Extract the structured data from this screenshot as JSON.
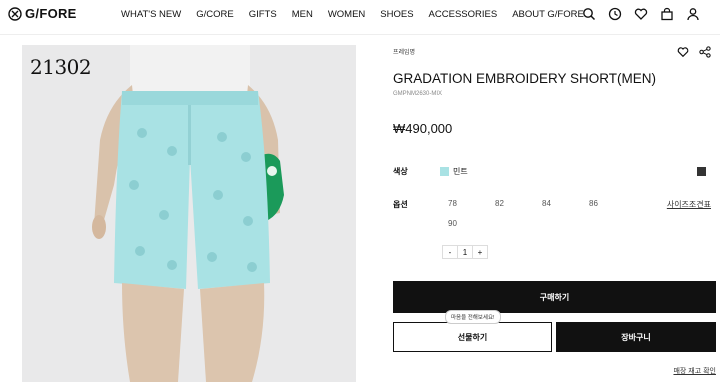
{
  "header": {
    "logo_text": "G/FORE",
    "nav": [
      "WHAT'S NEW",
      "G/CORE",
      "GIFTS",
      "MEN",
      "WOMEN",
      "SHOES",
      "ACCESSORIES",
      "ABOUT G/FORE"
    ],
    "icons": [
      "search-icon",
      "clock-icon",
      "heart-icon",
      "bag-icon",
      "user-icon"
    ]
  },
  "photo": {
    "id_text": "21302"
  },
  "product": {
    "brand": "프레임명",
    "title": "GRADATION EMBROIDERY SHORT(MEN)",
    "code": "GMPNM2630-MIX",
    "price": "₩490,000",
    "color_label": "색상",
    "color_name": "민트",
    "color_hex": "#a9e2e4",
    "option_label": "옵션",
    "sizes": [
      "78",
      "82",
      "84",
      "86",
      "90"
    ],
    "size_guide": "사이즈조견표",
    "qty_minus": "-",
    "qty_value": "1",
    "qty_plus": "+",
    "buy_label": "구매하기",
    "tooltip": "마음을 전해보세요!",
    "gift_label": "선물하기",
    "cart_label": "장바구니",
    "store_stock": "매장 재고 확인"
  }
}
